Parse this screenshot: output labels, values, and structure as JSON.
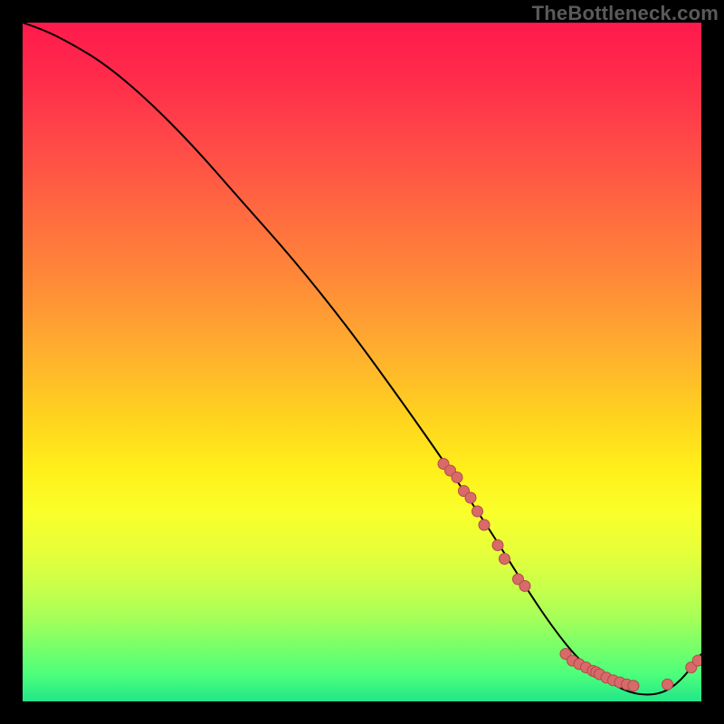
{
  "watermark": "TheBottleneck.com",
  "palette": {
    "curve_stroke": "#000000",
    "marker_fill": "#d86a6a",
    "marker_stroke": "#b24a4a",
    "background": "#000000"
  },
  "chart_data": {
    "type": "line",
    "title": "",
    "xlabel": "",
    "ylabel": "",
    "xlim": [
      0,
      100
    ],
    "ylim": [
      0,
      100
    ],
    "grid": false,
    "legend": false,
    "series": [
      {
        "name": "bottleneck-curve",
        "x": [
          0,
          3,
          7,
          12,
          18,
          25,
          32,
          40,
          48,
          56,
          63,
          69,
          74,
          78,
          82,
          86,
          90,
          94,
          97,
          100
        ],
        "y": [
          100,
          99,
          97,
          94,
          89,
          82,
          74,
          65,
          55,
          44,
          34,
          25,
          17,
          11,
          6,
          3,
          1,
          1,
          3,
          7
        ]
      }
    ],
    "markers": [
      {
        "name": "cluster-upper",
        "points": [
          {
            "x": 62,
            "y": 35
          },
          {
            "x": 63,
            "y": 34
          },
          {
            "x": 64,
            "y": 33
          },
          {
            "x": 65,
            "y": 31
          },
          {
            "x": 66,
            "y": 30
          },
          {
            "x": 67,
            "y": 28
          },
          {
            "x": 68,
            "y": 26
          }
        ]
      },
      {
        "name": "cluster-lower",
        "points": [
          {
            "x": 70,
            "y": 23
          },
          {
            "x": 71,
            "y": 21
          },
          {
            "x": 73,
            "y": 18
          },
          {
            "x": 74,
            "y": 17
          }
        ]
      },
      {
        "name": "bottom-run",
        "points": [
          {
            "x": 80,
            "y": 7
          },
          {
            "x": 81,
            "y": 6
          },
          {
            "x": 82,
            "y": 5.5
          },
          {
            "x": 83,
            "y": 5
          },
          {
            "x": 84,
            "y": 4.5
          },
          {
            "x": 84.5,
            "y": 4.3
          },
          {
            "x": 85,
            "y": 4
          },
          {
            "x": 86,
            "y": 3.5
          },
          {
            "x": 87,
            "y": 3.1
          },
          {
            "x": 88,
            "y": 2.8
          },
          {
            "x": 89,
            "y": 2.5
          },
          {
            "x": 90,
            "y": 2.3
          }
        ]
      },
      {
        "name": "far-right-pair",
        "points": [
          {
            "x": 95,
            "y": 2.5
          },
          {
            "x": 98.5,
            "y": 5
          },
          {
            "x": 99.5,
            "y": 6
          }
        ]
      }
    ]
  }
}
